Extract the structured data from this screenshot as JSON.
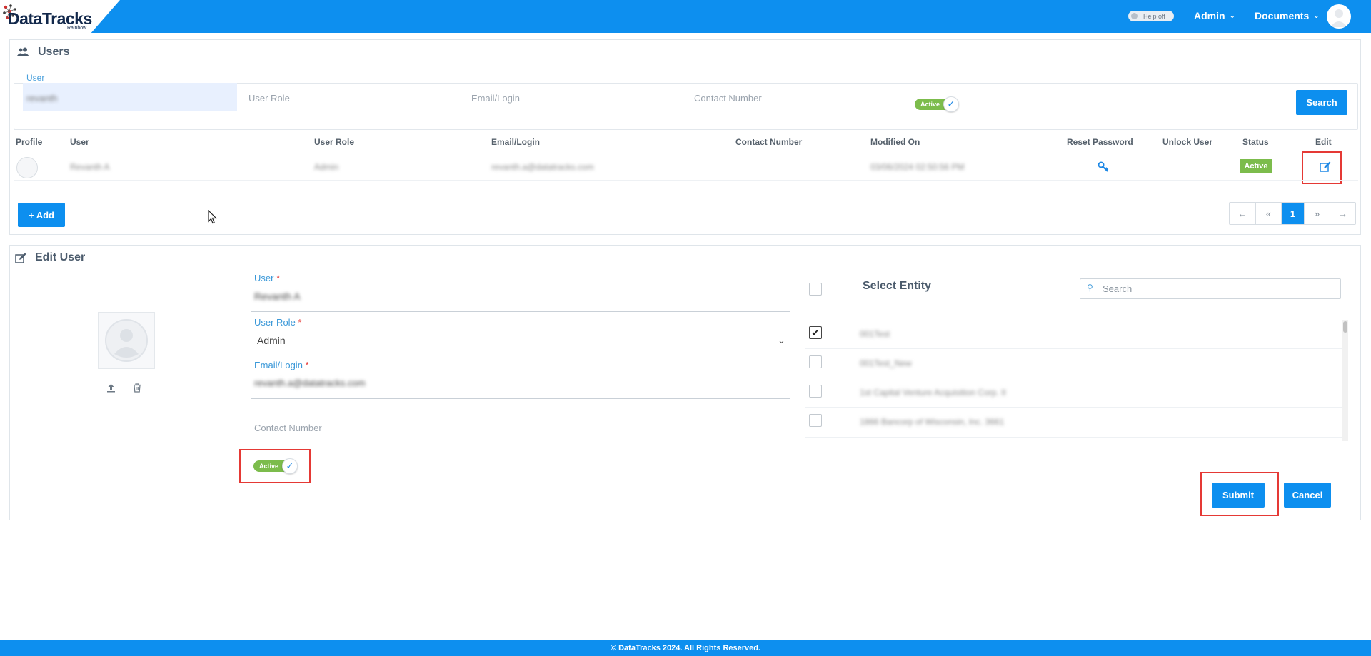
{
  "header": {
    "logo_text": "DataTracks",
    "logo_sub": "Rainbow",
    "help_toggle": "Help off",
    "nav": [
      {
        "label": "Admin"
      },
      {
        "label": "Documents"
      }
    ]
  },
  "users": {
    "title": "Users",
    "filters": {
      "user_label": "User",
      "user_value": "revanth",
      "role_placeholder": "User Role",
      "email_placeholder": "Email/Login",
      "contact_placeholder": "Contact Number",
      "active_label": "Active",
      "search_label": "Search"
    },
    "columns": [
      "Profile",
      "User",
      "User Role",
      "Email/Login",
      "Contact Number",
      "Modified On",
      "Reset Password",
      "Unlock User",
      "Status",
      "Edit"
    ],
    "rows": [
      {
        "user": "Revanth A",
        "role": "Admin",
        "email": "revanth.a@datatracks.com",
        "contact": "",
        "modified": "03/06/2024 02:50:56 PM",
        "status": "Active"
      }
    ],
    "add_label": "+ Add",
    "pager": [
      "←",
      "«",
      "1",
      "»",
      "→"
    ]
  },
  "edit_user": {
    "title": "Edit User",
    "user_label": "User",
    "user_value": "Revanth A",
    "role_label": "User Role",
    "role_value": "Admin",
    "email_label": "Email/Login",
    "email_value": "revanth.a@datatracks.com",
    "contact_placeholder": "Contact Number",
    "active_label": "Active",
    "entity_title": "Select Entity",
    "entity_search_placeholder": "Search",
    "entities": [
      {
        "name": "001Test",
        "checked": true
      },
      {
        "name": "001Test_New",
        "checked": false
      },
      {
        "name": "1st Capital Venture Acquisition Corp. II",
        "checked": false
      },
      {
        "name": "1866 Bancorp of Wisconsin, Inc. 3661",
        "checked": false
      }
    ],
    "submit_label": "Submit",
    "cancel_label": "Cancel"
  },
  "footer": {
    "text": "© DataTracks 2024. All Rights Reserved."
  },
  "colors": {
    "primary": "#0d8fef",
    "active_green": "#7cbc4c",
    "highlight_red": "#e53935"
  }
}
